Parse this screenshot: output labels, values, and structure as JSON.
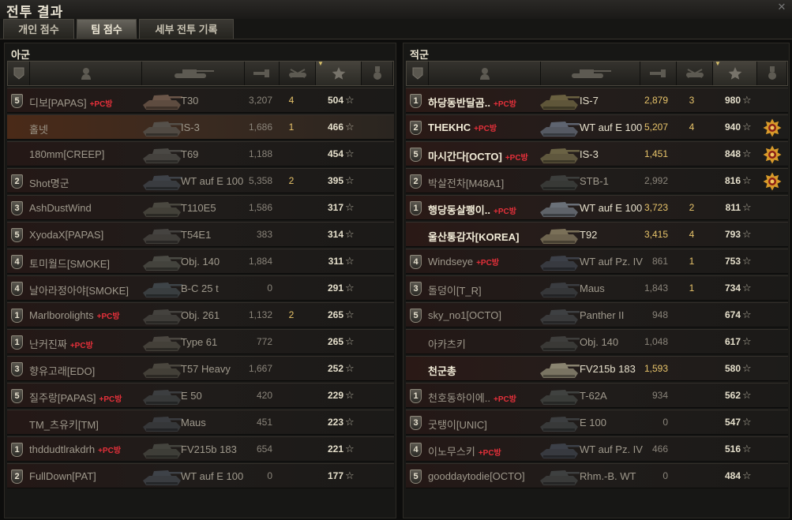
{
  "window": {
    "title": "전투 결과"
  },
  "tabs": [
    {
      "label": "개인 점수",
      "active": false
    },
    {
      "label": "팀 점수",
      "active": true
    },
    {
      "label": "세부 전투 기록",
      "active": false
    }
  ],
  "pc_tag": "+PC방",
  "allies": {
    "title": "아군",
    "players": [
      {
        "squad": "5",
        "name": "디보[PAPAS]",
        "pc": true,
        "tank": "T30",
        "damage": "3,207",
        "kills": "4",
        "xp": "504",
        "state": "dead",
        "tank_color": "#6a5548"
      },
      {
        "squad": "",
        "name": "홀넷",
        "pc": false,
        "tank": "IS-3",
        "damage": "1,686",
        "kills": "1",
        "xp": "466",
        "state": "self",
        "tank_color": "#55504a"
      },
      {
        "squad": "",
        "name": "180mm[CREEP]",
        "pc": false,
        "tank": "T69",
        "damage": "1,188",
        "kills": "",
        "xp": "454",
        "state": "dead",
        "tank_color": "#4a4844"
      },
      {
        "squad": "2",
        "name": "Shot명군",
        "pc": false,
        "tank": "WT auf E 100",
        "damage": "5,358",
        "kills": "2",
        "xp": "395",
        "state": "dead",
        "tank_color": "#3e4248"
      },
      {
        "squad": "3",
        "name": "AshDustWind",
        "pc": false,
        "tank": "T110E5",
        "damage": "1,586",
        "kills": "",
        "xp": "317",
        "state": "dead",
        "tank_color": "#4a4840"
      },
      {
        "squad": "5",
        "name": "XyodaX[PAPAS]",
        "pc": false,
        "tank": "T54E1",
        "damage": "383",
        "kills": "",
        "xp": "314",
        "state": "dead",
        "tank_color": "#454340"
      },
      {
        "squad": "4",
        "name": "토미월드[SMOKE]",
        "pc": false,
        "tank": "Obj. 140",
        "damage": "1,884",
        "kills": "",
        "xp": "311",
        "state": "dead",
        "tank_color": "#4a4a44"
      },
      {
        "squad": "4",
        "name": "날아라정아야[SMOKE]",
        "pc": false,
        "tank": "B-C 25 t",
        "damage": "0",
        "kills": "",
        "xp": "291",
        "state": "dead",
        "tank_color": "#3e4448"
      },
      {
        "squad": "1",
        "name": "Marlborolights",
        "pc": true,
        "tank": "Obj. 261",
        "damage": "1,132",
        "kills": "2",
        "xp": "265",
        "state": "dead",
        "tank_color": "#44423e"
      },
      {
        "squad": "1",
        "name": "난커진짜",
        "pc": true,
        "tank": "Type 61",
        "damage": "772",
        "kills": "",
        "xp": "265",
        "state": "dead",
        "tank_color": "#4a4640"
      },
      {
        "squad": "3",
        "name": "향유고래[EDO]",
        "pc": false,
        "tank": "T57 Heavy",
        "damage": "1,667",
        "kills": "",
        "xp": "252",
        "state": "dead",
        "tank_color": "#4a463e"
      },
      {
        "squad": "5",
        "name": "질주랑[PAPAS]",
        "pc": true,
        "tank": "E 50",
        "damage": "420",
        "kills": "",
        "xp": "229",
        "state": "dead",
        "tank_color": "#3c3e40"
      },
      {
        "squad": "",
        "name": "TM_츠유키[TM]",
        "pc": false,
        "tank": "Maus",
        "damage": "451",
        "kills": "",
        "xp": "223",
        "state": "dead",
        "tank_color": "#3a3c40"
      },
      {
        "squad": "1",
        "name": "thddudtlrakdrh",
        "pc": true,
        "tank": "FV215b 183",
        "damage": "654",
        "kills": "",
        "xp": "221",
        "state": "dead",
        "tank_color": "#44443e"
      },
      {
        "squad": "2",
        "name": "FullDown[PAT]",
        "pc": false,
        "tank": "WT auf E 100",
        "damage": "0",
        "kills": "",
        "xp": "177",
        "state": "dead",
        "tank_color": "#3e4248"
      }
    ]
  },
  "enemies": {
    "title": "적군",
    "players": [
      {
        "squad": "1",
        "name": "하당동반달곰..",
        "pc": true,
        "tank": "IS-7",
        "damage": "2,879",
        "kills": "3",
        "xp": "980",
        "state": "alive",
        "medal": false,
        "tank_color": "#6a6040"
      },
      {
        "squad": "2",
        "name": "THEKHC",
        "pc": true,
        "tank": "WT auf E 100",
        "damage": "5,207",
        "kills": "4",
        "xp": "940",
        "state": "alive",
        "medal": true,
        "tank_color": "#5e6470"
      },
      {
        "squad": "5",
        "name": "마시간다[OCTO]",
        "pc": true,
        "tank": "IS-3",
        "damage": "1,451",
        "kills": "",
        "xp": "848",
        "state": "alive",
        "medal": true,
        "tank_color": "#6a6244"
      },
      {
        "squad": "2",
        "name": "박살전차[M48A1]",
        "pc": false,
        "tank": "STB-1",
        "damage": "2,992",
        "kills": "",
        "xp": "816",
        "state": "dead",
        "medal": true,
        "tank_color": "#3c3e3c"
      },
      {
        "squad": "1",
        "name": "행당동살쾡이..",
        "pc": true,
        "tank": "WT auf E 100",
        "damage": "3,723",
        "kills": "2",
        "xp": "811",
        "state": "alive",
        "medal": false,
        "tank_color": "#6a7078"
      },
      {
        "squad": "",
        "name": "울산통감자[KOREA]",
        "pc": false,
        "tank": "T92",
        "damage": "3,415",
        "kills": "4",
        "xp": "793",
        "state": "alive",
        "medal": false,
        "tank_color": "#7a7058"
      },
      {
        "squad": "4",
        "name": "Windseye",
        "pc": true,
        "tank": "WT auf Pz. IV",
        "damage": "861",
        "kills": "1",
        "xp": "753",
        "state": "dead",
        "medal": false,
        "tank_color": "#3c4048"
      },
      {
        "squad": "3",
        "name": "돌덩이[T_R]",
        "pc": false,
        "tank": "Maus",
        "damage": "1,843",
        "kills": "1",
        "xp": "734",
        "state": "dead",
        "medal": false,
        "tank_color": "#3a3c40"
      },
      {
        "squad": "5",
        "name": "sky_no1[OCTO]",
        "pc": false,
        "tank": "Panther II",
        "damage": "948",
        "kills": "",
        "xp": "674",
        "state": "dead",
        "medal": false,
        "tank_color": "#3e4042"
      },
      {
        "squad": "",
        "name": "아카츠키",
        "pc": false,
        "tank": "Obj. 140",
        "damage": "1,048",
        "kills": "",
        "xp": "617",
        "state": "dead",
        "medal": false,
        "tank_color": "#3e3e3c"
      },
      {
        "squad": "",
        "name": "천군총",
        "pc": false,
        "tank": "FV215b 183",
        "damage": "1,593",
        "kills": "",
        "xp": "580",
        "state": "alive",
        "medal": false,
        "tank_color": "#8a8470"
      },
      {
        "squad": "1",
        "name": "천호동하이에..",
        "pc": true,
        "tank": "T-62A",
        "damage": "934",
        "kills": "",
        "xp": "562",
        "state": "dead",
        "medal": false,
        "tank_color": "#404240"
      },
      {
        "squad": "3",
        "name": "굿탱이[UNIC]",
        "pc": false,
        "tank": "E 100",
        "damage": "0",
        "kills": "",
        "xp": "547",
        "state": "dead",
        "medal": false,
        "tank_color": "#3c3e40"
      },
      {
        "squad": "4",
        "name": "이노무스키",
        "pc": true,
        "tank": "WT auf Pz. IV",
        "damage": "466",
        "kills": "",
        "xp": "516",
        "state": "dead",
        "medal": false,
        "tank_color": "#3c4048"
      },
      {
        "squad": "5",
        "name": "gooddaytodie[OCTO]",
        "pc": false,
        "tank": "Rhm.-B. WT",
        "damage": "0",
        "kills": "",
        "xp": "484",
        "state": "dead",
        "medal": false,
        "tank_color": "#3e4040"
      }
    ]
  },
  "colors": {
    "pc_tag": "#e4303a",
    "damage_alive": "#e8c46a",
    "medal": "#d89a2a"
  }
}
